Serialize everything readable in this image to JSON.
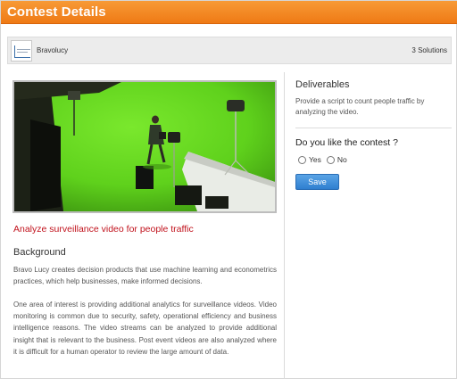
{
  "header": {
    "title": "Contest Details"
  },
  "company": {
    "name": "Bravolucy",
    "solutions": "3 Solutions"
  },
  "contest": {
    "title": "Analyze surveillance video for people traffic",
    "background_heading": "Background",
    "background_paragraphs": [
      "Bravo Lucy creates decision products that use machine learning and econometrics practices, which help businesses, make informed decisions.",
      "One area of interest is providing additional analytics for surveillance videos. Video monitoring is common due to security, safety, operational efficiency and business intelligence reasons. The video streams can be analyzed to provide additional insight that is relevant to the business. Post event videos are also analyzed where it is difficult for a human operator to review the large amount of data."
    ]
  },
  "sidebar": {
    "deliverables_heading": "Deliverables",
    "deliverables_text": "Provide a script to count people traffic by analyzing the video.",
    "like_question": "Do you like the contest ?",
    "options": [
      "Yes",
      "No"
    ],
    "save_label": "Save"
  },
  "colors": {
    "header_orange": "#ef7a15",
    "title_red": "#c1121c",
    "button_blue": "#2f7fd0",
    "greenscreen": "#5fd11c"
  },
  "icons": {
    "radio": "radio-button-icon",
    "logo": "company-logo-icon"
  }
}
